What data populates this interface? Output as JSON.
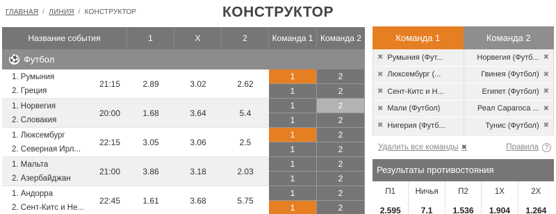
{
  "breadcrumbs": [
    "ГЛАВНАЯ",
    "ЛИНИЯ",
    "КОНСТРУКТОР"
  ],
  "page_title": "КОНСТРУКТОР",
  "table": {
    "headers": {
      "name": "Название события",
      "o1": "1",
      "ox": "X",
      "o2": "2",
      "t1": "Команда 1",
      "t2": "Команда 2"
    },
    "sport": "Футбол",
    "events": [
      {
        "team1": "1. Румыния",
        "team2": "2. Греция",
        "time": "21:15",
        "o1": "2.89",
        "ox": "3.02",
        "o2": "2.62",
        "t1a": "1",
        "t1b": "1",
        "t2a": "2",
        "t2b": "2"
      },
      {
        "team1": "1. Норвегия",
        "team2": "2. Словакия",
        "time": "20:00",
        "o1": "1.68",
        "ox": "3.64",
        "o2": "5.4",
        "t1a": "1",
        "t1b": "1",
        "t2a": "2",
        "t2b": "2"
      },
      {
        "team1": "1. Люксембург",
        "team2": "2. Северная Ирл...",
        "time": "22:15",
        "o1": "3.05",
        "ox": "3.06",
        "o2": "2.5",
        "t1a": "1",
        "t1b": "1",
        "t2a": "2",
        "t2b": "2"
      },
      {
        "team1": "1. Мальта",
        "team2": "2. Азербайджан",
        "time": "21:00",
        "o1": "3.86",
        "ox": "3.18",
        "o2": "2.03",
        "t1a": "1",
        "t1b": "1",
        "t2a": "2",
        "t2b": "2"
      },
      {
        "team1": "1. Андорра",
        "team2": "2. Сент-Китс и Не...",
        "time": "22:45",
        "o1": "1.61",
        "ox": "3.68",
        "o2": "5.75",
        "t1a": "1",
        "t1b": "1",
        "t2a": "2",
        "t2b": "2"
      }
    ]
  },
  "panel": {
    "tab1": "Команда 1",
    "tab2": "Команда 2",
    "team1_list": [
      "Румыния (Фут...",
      "Люксембург (...",
      "Сент-Китс и Н...",
      "Мали (Футбол)",
      "Нигерия (Футб..."
    ],
    "team2_list": [
      "Норвегия (Футб...",
      "Гвинея (Футбол)",
      "Египет (Футбол)",
      "Реал Сарагоса ...",
      "Тунис (Футбол)"
    ],
    "remove_glyph": "✖",
    "clear_all": "Удалить все команды",
    "rules": "Правила",
    "help_glyph": "?",
    "results_title": "Результаты противостояния",
    "results_headers": [
      "П1",
      "Ничья",
      "П2",
      "1X",
      "2X"
    ],
    "results_values": [
      "2.595",
      "7.1",
      "1.536",
      "1.904",
      "1.264"
    ]
  },
  "colors": {
    "accent": "#e67e22",
    "header_gray": "#767676",
    "cell_gray": "#757575"
  },
  "icons": {
    "sport": "soccer-ball-icon",
    "remove": "close-icon",
    "help": "question-icon"
  }
}
